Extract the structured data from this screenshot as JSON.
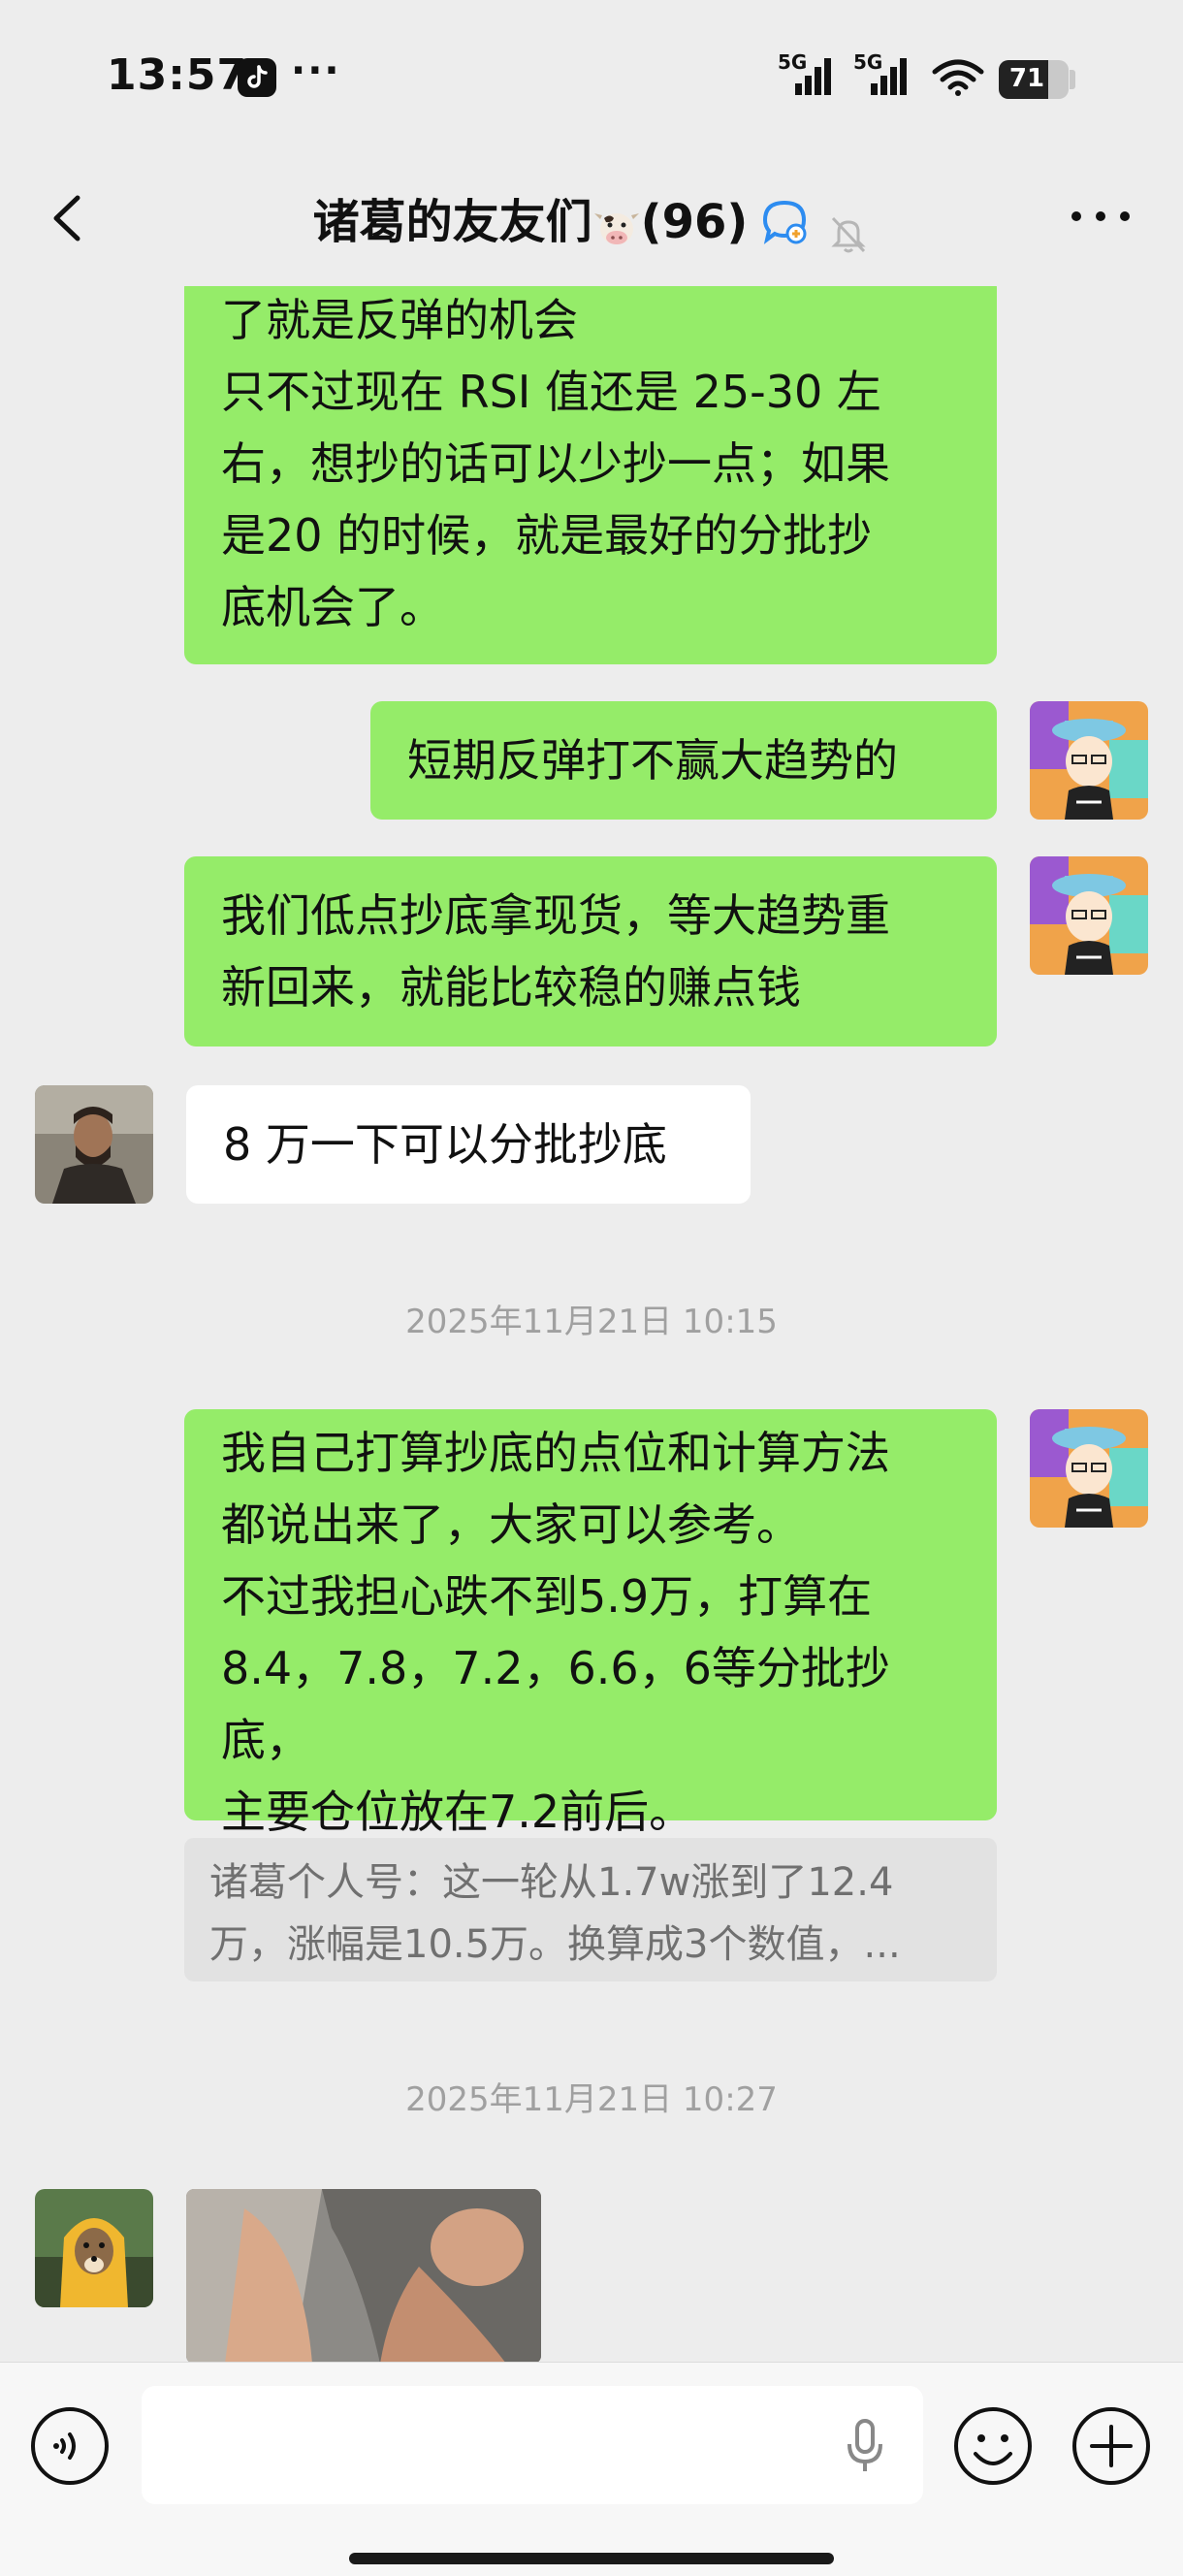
{
  "status_bar": {
    "time": "13:57",
    "dots": "···",
    "signal_1": "5G",
    "signal_2": "5G",
    "battery": "71",
    "battery_level": 0.71
  },
  "header": {
    "title": "诸葛的友友们",
    "member_count": "(96)"
  },
  "messages": [
    {
      "lines": [
        "了就是反弹的机会",
        "只不过现在 RSI 值还是 25-30 左",
        "右，想抄的话可以少抄一点；如果",
        "是20 的时候，就是最好的分批抄",
        "底机会了。"
      ]
    },
    {
      "lines": [
        "短期反弹打不赢大趋势的"
      ]
    },
    {
      "lines": [
        "我们低点抄底拿现货，等大趋势重",
        "新回来，就能比较稳的赚点钱"
      ]
    },
    {
      "lines": [
        "8 万一下可以分批抄底"
      ]
    },
    {
      "timestamp": "2025年11月21日 10:15"
    },
    {
      "lines": [
        "我自己打算抄底的点位和计算方法",
        "都说出来了，大家可以参考。",
        "不过我担心跌不到5.9万，打算在",
        "8.4，7.8，7.2，6.6，6等分批抄底，",
        "主要仓位放在7.2前后。"
      ]
    },
    {
      "quote_lines": [
        "诸葛个人号：这一轮从1.7w涨到了12.4",
        "万，涨幅是10.5万。换算成3个数值，..."
      ]
    },
    {
      "timestamp": "2025年11月21日 10:27"
    }
  ],
  "input": {
    "placeholder": ""
  },
  "colors": {
    "self_bubble": "#95ec69",
    "other_bubble": "#ffffff",
    "background": "#ededed"
  }
}
